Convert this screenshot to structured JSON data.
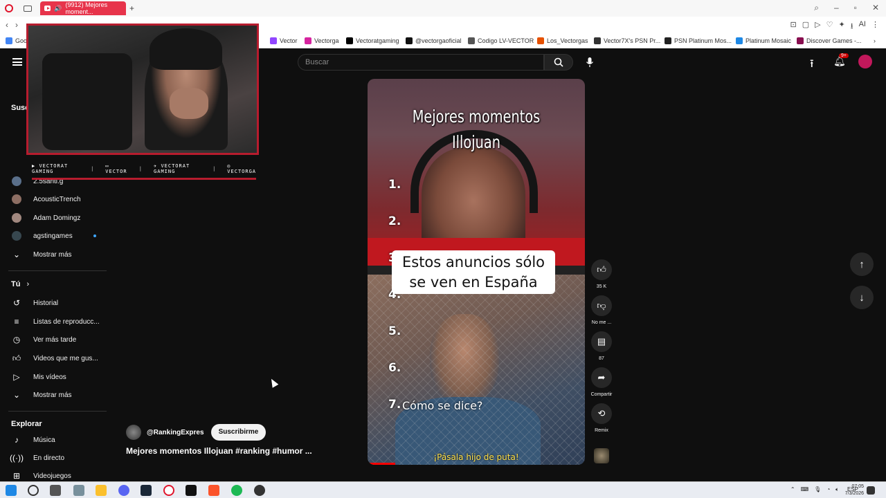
{
  "browser": {
    "tab_title": "(9912) Mejores moment...",
    "bookmarks": [
      "Goog",
      "Vector",
      "Vectorga",
      "Vectoratgaming",
      "@vectorgaoficial",
      "Codigo LV-VECTOR",
      "Los_Vectorgas",
      "Vector7X's PSN Pr...",
      "PSN Platinum Mos...",
      "Platinum Mosaic",
      "Discover Games -..."
    ]
  },
  "youtube": {
    "search_placeholder": "Buscar",
    "notif_count": "9+"
  },
  "sidebar": {
    "subs_header": "Susc",
    "subs": [
      "2.5santi.g",
      "AcousticTrench",
      "Adam Domingz",
      "agstingames"
    ],
    "show_more_1": "Mostrar más",
    "you_header": "Tú",
    "you_items": [
      "Historial",
      "Listas de reproducc...",
      "Ver más tarde",
      "Videos que me gus...",
      "Mis vídeos"
    ],
    "show_more_2": "Mostrar más",
    "explore_header": "Explorar",
    "explore_items": [
      "Música",
      "En directo",
      "Videojuegos"
    ]
  },
  "overlay": {
    "social": [
      "VECTORAT GAMING",
      "VECTOR",
      "VECTORAT GAMING",
      "VECTORGA"
    ]
  },
  "short": {
    "title_line1": "Mejores momentos",
    "title_line2": "Illojuan",
    "numbers": [
      "1.",
      "2.",
      "3.",
      "4.",
      "5.",
      "6.",
      "7."
    ],
    "caption_line1": "Estos anuncios sólo",
    "caption_line2": "se ven en España",
    "q7_text": "Cómo se dice?",
    "subtitle": "¡Pásala hijo de puta!",
    "channel_handle": "@RankingExpres",
    "subscribe_label": "Suscribirme",
    "video_title": "Mejores momentos Illojuan #ranking #humor ..."
  },
  "actions": {
    "likes": "35 K",
    "dislike_label": "No me ...",
    "comments": "87",
    "share_label": "Compartir",
    "remix_label": "Remix"
  },
  "taskbar": {
    "lang": "ESP",
    "time": "07:05",
    "date": "7/3/2026"
  },
  "colors": {
    "accent_red": "#b71c2e",
    "yt_bg": "#0f0f0f"
  }
}
